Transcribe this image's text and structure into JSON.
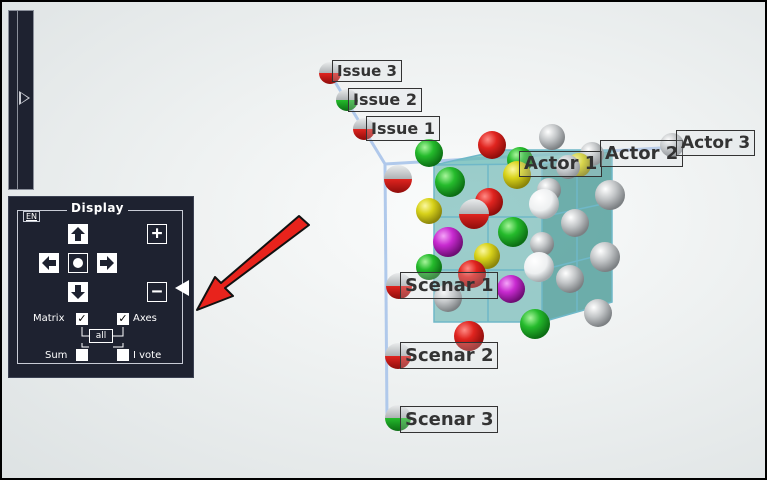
{
  "panel": {
    "title": "Display",
    "language": "EN",
    "plus_label": "+",
    "minus_label": "−",
    "matrix_label": "Matrix",
    "axes_label": "Axes",
    "all_label": "all",
    "sum_label": "Sum",
    "ivote_label": "I vote",
    "matrix_checked": true,
    "axes_checked": true,
    "sum_checked": false,
    "ivote_checked": false
  },
  "issues": [
    "Issue 3",
    "Issue 2",
    "Issue 1"
  ],
  "actors": [
    "Actor 1",
    "Actor 2",
    "Actor 3"
  ],
  "scenarios": [
    "Scenar 1",
    "Scenar 2",
    "Scenar 3"
  ],
  "colors": {
    "panel_bg": "#1e2230",
    "arrow": "#e8231c",
    "cube": "#4fa7a4",
    "axis": "#a9c4ea",
    "red": "#d9231f",
    "green": "#23b82b",
    "yellow": "#d8d21a",
    "magenta": "#c82ad0",
    "gray": "#b5b8ba",
    "white": "#f2f4f5"
  }
}
